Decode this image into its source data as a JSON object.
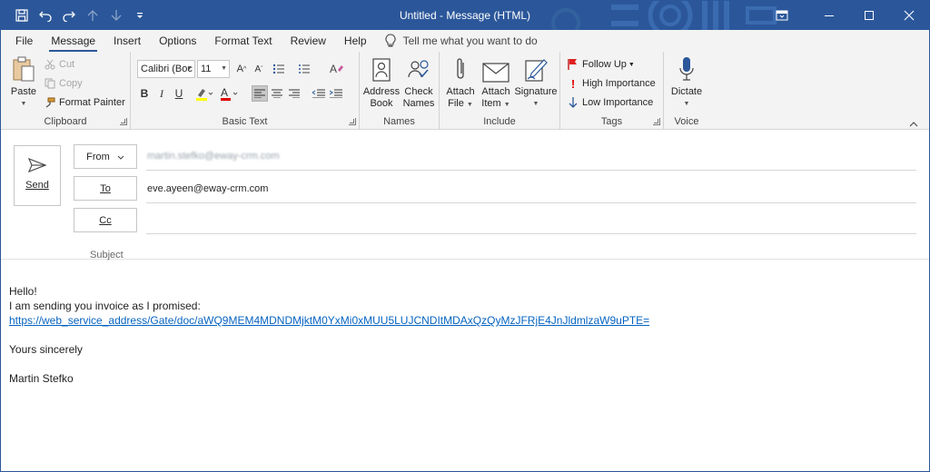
{
  "titlebar": {
    "title": "Untitled  -  Message (HTML)",
    "accent": "#2b579a"
  },
  "qat": {
    "icons": [
      "save-icon",
      "undo-icon",
      "redo-icon",
      "up-arrow-icon",
      "down-arrow-icon",
      "customize-icon"
    ]
  },
  "tabs": [
    {
      "label": "File"
    },
    {
      "label": "Message"
    },
    {
      "label": "Insert"
    },
    {
      "label": "Options"
    },
    {
      "label": "Format Text"
    },
    {
      "label": "Review"
    },
    {
      "label": "Help"
    }
  ],
  "tellme": {
    "label": "Tell me what you want to do"
  },
  "ribbon": {
    "clipboard": {
      "label": "Clipboard",
      "paste": "Paste",
      "cut": "Cut",
      "copy": "Copy",
      "format_painter": "Format Painter"
    },
    "basic_text": {
      "label": "Basic Text",
      "font": "Calibri (Boc",
      "size": "11",
      "bold": "B",
      "italic": "I",
      "underline": "U"
    },
    "names": {
      "label": "Names",
      "address_book_1": "Address",
      "address_book_2": "Book",
      "check_names_1": "Check",
      "check_names_2": "Names"
    },
    "include": {
      "label": "Include",
      "attach_file_1": "Attach",
      "attach_file_2": "File",
      "attach_item_1": "Attach",
      "attach_item_2": "Item",
      "signature": "Signature"
    },
    "tags": {
      "label": "Tags",
      "follow_up": "Follow Up",
      "high": "High Importance",
      "low": "Low Importance"
    },
    "voice": {
      "label": "Voice",
      "dictate": "Dictate"
    }
  },
  "compose": {
    "send": "Send",
    "from_label": "From",
    "from_value": "martin.stefko@eway-crm.com",
    "to_label": "To",
    "to_value": "eve.ayeen@eway-crm.com",
    "cc_label": "Cc",
    "subject_label": "Subject"
  },
  "body": {
    "greeting": "Hello!",
    "line1": "I am sending you invoice as I promised:",
    "link": "https://web_service_address/Gate/doc/aWQ9MEM4MDNDMjktM0YxMi0xMUU5LUJCNDItMDAxQzQyMzJFRjE4JnJldmlzaW9uPTE=",
    "closing": "Yours sincerely",
    "signature": "Martin Stefko"
  }
}
